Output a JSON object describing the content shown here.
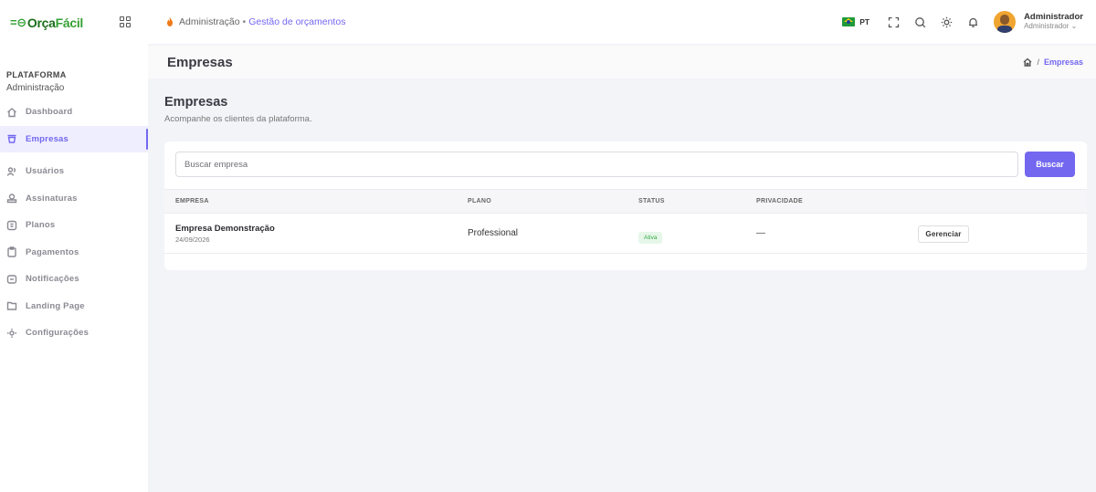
{
  "brand": {
    "logo_prefix": "Orça",
    "logo_suffix": "Fácil"
  },
  "sidebar": {
    "section_title": "PLATAFORMA",
    "section_subtitle": "Administração",
    "items": [
      {
        "label": "Dashboard",
        "icon": "home-icon",
        "active": false
      },
      {
        "label": "Empresas",
        "icon": "building-icon",
        "active": true
      },
      {
        "label": "Usuários",
        "icon": "users-icon",
        "active": false
      },
      {
        "label": "Assinaturas",
        "icon": "subscription-icon",
        "active": false
      },
      {
        "label": "Planos",
        "icon": "plans-icon",
        "active": false
      },
      {
        "label": "Pagamentos",
        "icon": "clipboard-icon",
        "active": false
      },
      {
        "label": "Notificações",
        "icon": "bell-box-icon",
        "active": false
      },
      {
        "label": "Landing Page",
        "icon": "folder-icon",
        "active": false
      },
      {
        "label": "Configurações",
        "icon": "settings-icon",
        "active": false
      }
    ]
  },
  "topbar": {
    "breadcrumb_root": "Administração",
    "breadcrumb_sep": "•",
    "breadcrumb_current": "Gestão de orçamentos",
    "language": "PT",
    "user_name": "Administrador",
    "user_role": "Administrador ⌄"
  },
  "page_header": {
    "title": "Empresas",
    "crumb_sep": "/",
    "crumb_current": "Empresas"
  },
  "content": {
    "title": "Empresas",
    "subtitle": "Acompanhe os clientes da plataforma.",
    "search": {
      "placeholder": "Buscar empresa",
      "value": "",
      "button_label": "Buscar"
    },
    "table": {
      "columns": [
        "EMPRESA",
        "PLANO",
        "STATUS",
        "PRIVACIDADE"
      ],
      "rows": [
        {
          "name": "Empresa Demonstração",
          "date": "24/09/2026",
          "plan": "Professional",
          "status": "Ativa",
          "privacy": "—",
          "action": "Gerenciar"
        }
      ]
    }
  },
  "colors": {
    "accent": "#7367f0",
    "success": "#36a84a",
    "brand_green": "#1f7a1f"
  }
}
